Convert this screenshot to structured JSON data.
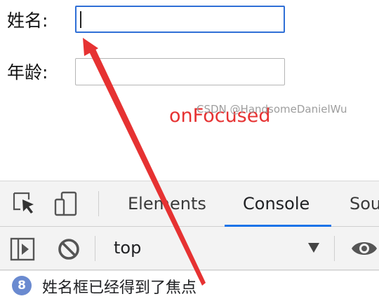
{
  "form": {
    "name_label": "姓名:",
    "name_value": "",
    "age_label": "年龄:",
    "age_value": ""
  },
  "annotation": {
    "text": "onFocused",
    "color": "#e63232"
  },
  "devtools": {
    "tabs": [
      {
        "label": "Elements",
        "active": false
      },
      {
        "label": "Console",
        "active": true
      },
      {
        "label": "Sou",
        "active": false
      }
    ],
    "context_selector": "top",
    "message_count": "8",
    "message_text": "姓名框已经得到了焦点",
    "accent_color": "#1a73e8",
    "icons": [
      "inspect-element-icon",
      "device-toolbar-icon",
      "sidebar-toggle-icon",
      "clear-console-icon",
      "dropdown-arrow-icon",
      "eye-icon"
    ]
  },
  "watermark": "CSDN @HandsomeDanielWu"
}
